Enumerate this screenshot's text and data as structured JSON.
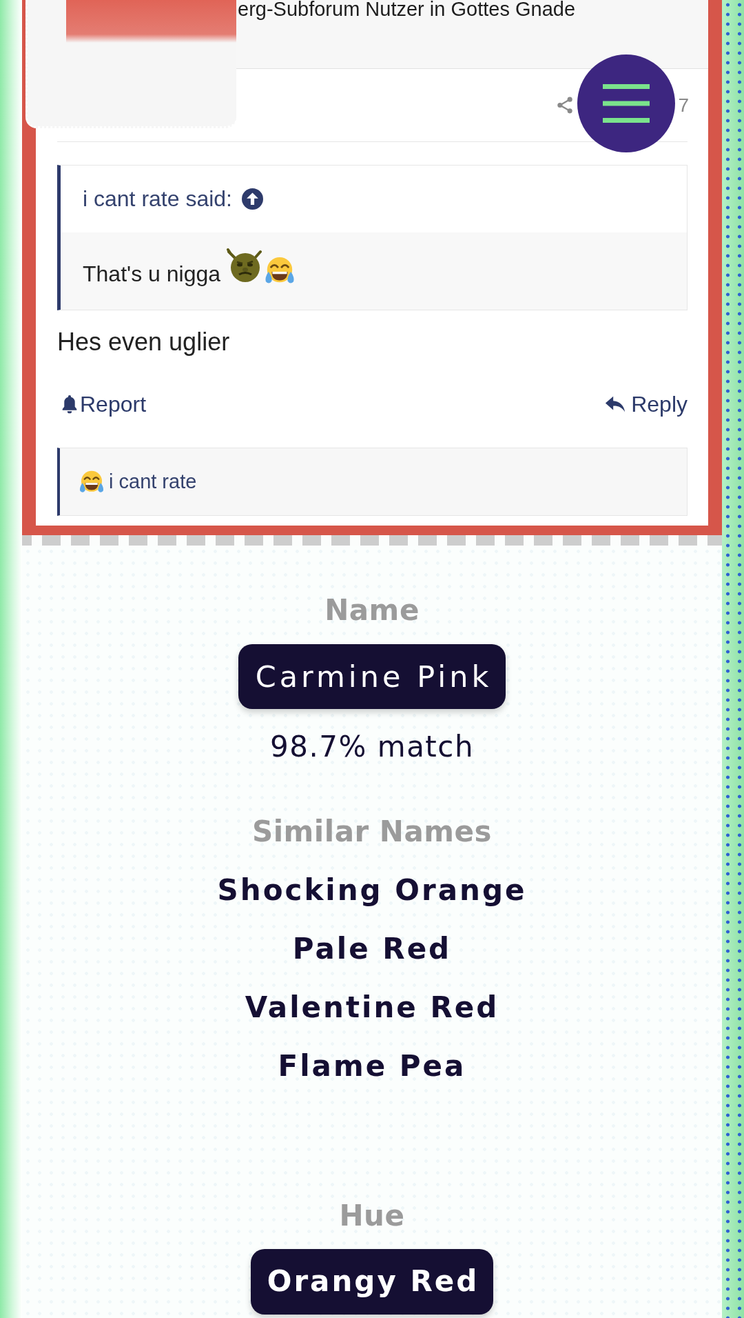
{
  "post": {
    "user_title": "erg-Subforum Nutzer in Gottes Gnade",
    "post_number": "7",
    "quote": {
      "author_line": "i cant rate said:",
      "text": "That's u nigga"
    },
    "message": "Hes even uglier",
    "actions": {
      "report": "Report",
      "reply": "Reply"
    },
    "reaction_user": "i cant rate"
  },
  "color_info": {
    "name_heading": "Name",
    "name": "Carmine Pink",
    "match": "98.7% match",
    "similar_heading": "Similar Names",
    "similar_names": [
      "Shocking Orange",
      "Pale Red",
      "Valentine Red",
      "Flame Pea"
    ],
    "hue_heading": "Hue",
    "hue": "Orangy Red"
  }
}
